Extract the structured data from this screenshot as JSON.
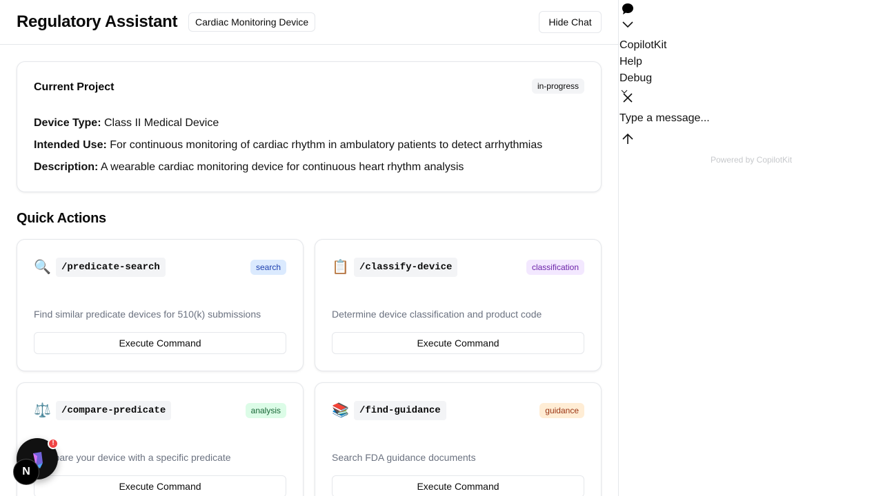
{
  "header": {
    "title": "Regulatory Assistant",
    "project_badge": "Cardiac Monitoring Device",
    "hide_chat": "Hide Chat"
  },
  "project": {
    "title": "Current Project",
    "status": "in-progress",
    "fields": [
      {
        "label": "Device Type:",
        "value": "Class II Medical Device"
      },
      {
        "label": "Intended Use:",
        "value": "For continuous monitoring of cardiac rhythm in ambulatory patients to detect arrhythmias"
      },
      {
        "label": "Description:",
        "value": "A wearable cardiac monitoring device for continuous heart rhythm analysis"
      }
    ]
  },
  "quick_actions": {
    "title": "Quick Actions",
    "commands": [
      {
        "emoji": "🔍",
        "command": "/predicate-search",
        "tag": "search",
        "description": "Find similar predicate devices for 510(k) submissions",
        "button": "Execute Command",
        "tag_bg": "#dbeafe",
        "tag_fg": "#1e40af"
      },
      {
        "emoji": "📋",
        "command": "/classify-device",
        "tag": "classification",
        "description": "Determine device classification and product code",
        "button": "Execute Command",
        "tag_bg": "#f3e8ff",
        "tag_fg": "#6b21a8"
      },
      {
        "emoji": "⚖️",
        "command": "/compare-predicate",
        "tag": "analysis",
        "description": "Compare your device with a specific predicate",
        "button": "Execute Command",
        "tag_bg": "#dcfce7",
        "tag_fg": "#166534"
      },
      {
        "emoji": "📚",
        "command": "/find-guidance",
        "tag": "guidance",
        "description": "Search FDA guidance documents",
        "button": "Execute Command",
        "tag_bg": "#ffedd5",
        "tag_fg": "#9a3412"
      }
    ]
  },
  "floating": {
    "notice": "!",
    "next_badge": "N"
  },
  "chat": {
    "menu": [
      "CopilotKit",
      "Help",
      "Debug"
    ],
    "input_placeholder": "Type a message...",
    "powered_by": "Powered by CopilotKit"
  }
}
